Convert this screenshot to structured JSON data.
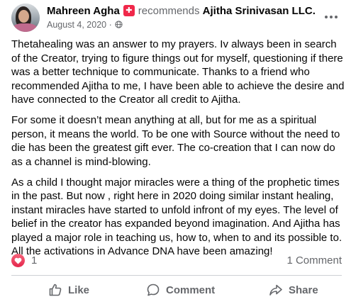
{
  "post": {
    "author": "Mahreen Agha",
    "recommends_text": "recommends",
    "business": "Ajitha Srinivasan LLC.",
    "date": "August 4, 2020",
    "separator": "·",
    "body": [
      "Thetahealing was an answer to my prayers. Iv always been in search of the Creator, trying to figure things out for myself, questioning if there was a better technique to communicate. Thanks to a friend who recommended Ajitha to me, I have been able to achieve the desire and have connected to the Creator all credit to Ajitha.",
      "For some it doesn’t mean anything at all, but for me as a spiritual person, it means the world. To be one with Source without the need to die has been the greatest gift ever. The co-creation that I can now do as a channel is mind-blowing.",
      "As a child I thought major miracles were a thing of the prophetic times in the past.  But now , right here in 2020 doing similar instant healing, instant miracles have started to unfold infront of my eyes. The level of belief in the creator has expanded beyond imagination. And Ajitha has played a major role in teaching us, how to, when to and its possible to. All the activations in Advance DNA have been amazing!"
    ]
  },
  "reactions": {
    "count": "1",
    "comments": "1 Comment"
  },
  "actions": {
    "like": "Like",
    "comment": "Comment",
    "share": "Share"
  },
  "colors": {
    "recommend_badge": "#f0284a",
    "secondary_text": "#65676b",
    "heart": "#e4264b"
  },
  "icons": {
    "recommend": "recommend-badge-icon",
    "privacy": "globe-icon",
    "more": "more-options-icon",
    "reaction": "love-reaction-icon",
    "like": "thumbs-up-icon",
    "comment": "comment-bubble-icon",
    "share": "share-arrow-icon"
  }
}
